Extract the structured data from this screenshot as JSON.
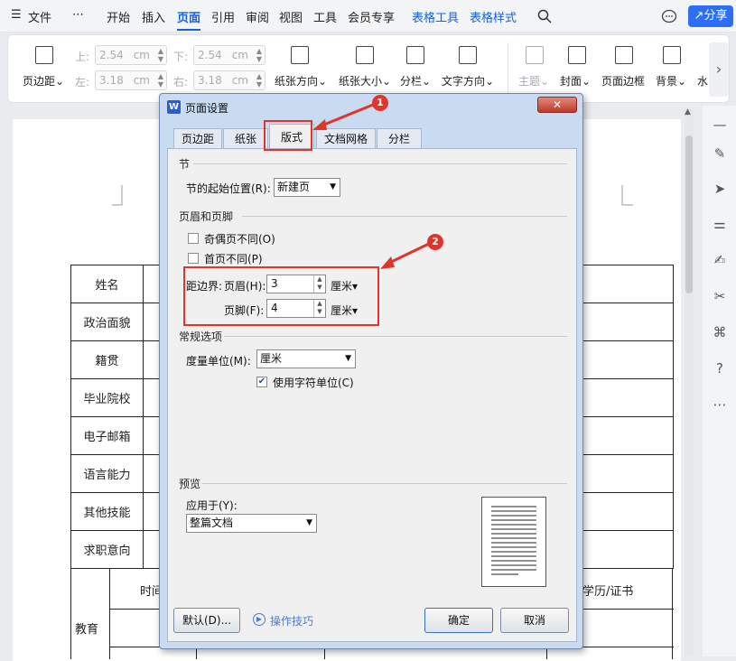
{
  "menubar": {
    "hamburger": "☰",
    "file": "文件",
    "more": "⋯",
    "tabs": [
      "开始",
      "插入",
      "页面",
      "引用",
      "审阅",
      "视图",
      "工具",
      "会员专享",
      "表格工具",
      "表格样式"
    ],
    "active_tab": "页面",
    "share": "分享"
  },
  "ribbon": {
    "margins": "页边距",
    "top_label": "上:",
    "top_value": "2.54",
    "bottom_label": "下:",
    "bottom_value": "2.54",
    "left_label": "左:",
    "left_value": "3.18",
    "right_label": "右:",
    "right_value": "3.18",
    "unit": "cm",
    "orientation": "纸张方向",
    "size": "纸张大小",
    "columns": "分栏",
    "text_direction": "文字方向",
    "theme": "主题",
    "cover": "封面",
    "page_border": "页面边框",
    "background": "背景",
    "watermark_partial": "水"
  },
  "document": {
    "table_labels": [
      "姓名",
      "政治面貌",
      "籍贯",
      "毕业院校",
      "电子邮箱",
      "语言能力",
      "其他技能",
      "求职意向"
    ],
    "education": "教育",
    "time_partial": "时间",
    "degree": "学历/证书"
  },
  "dialog": {
    "title": "页面设置",
    "close": "✕",
    "tabs": [
      "页边距",
      "纸张",
      "版式",
      "文档网格",
      "分栏"
    ],
    "active_tab": "版式",
    "section": {
      "title": "节",
      "start_label": "节的起始位置(R):",
      "start_value": "新建页"
    },
    "header_footer": {
      "title": "页眉和页脚",
      "odd_even": "奇偶页不同(O)",
      "odd_even_checked": false,
      "first_page": "首页不同(P)",
      "first_page_checked": false,
      "distance_label": "距边界:",
      "header_label": "页眉(H):",
      "header_value": "3",
      "footer_label": "页脚(F):",
      "footer_value": "4",
      "unit": "厘米"
    },
    "general": {
      "title": "常规选项",
      "measure_label": "度量单位(M):",
      "measure_value": "厘米",
      "use_char_units": "使用字符单位(C)",
      "use_char_units_checked": true
    },
    "preview": {
      "title": "预览",
      "apply_label": "应用于(Y):",
      "apply_value": "整篇文档"
    },
    "buttons": {
      "default": "默认(D)...",
      "tips": "操作技巧",
      "ok": "确定",
      "cancel": "取消"
    }
  },
  "annotations": {
    "badge_1": "1",
    "badge_2": "2"
  },
  "colors": {
    "accent": "#1a5fe0",
    "annotation_red": "#e0352b"
  }
}
